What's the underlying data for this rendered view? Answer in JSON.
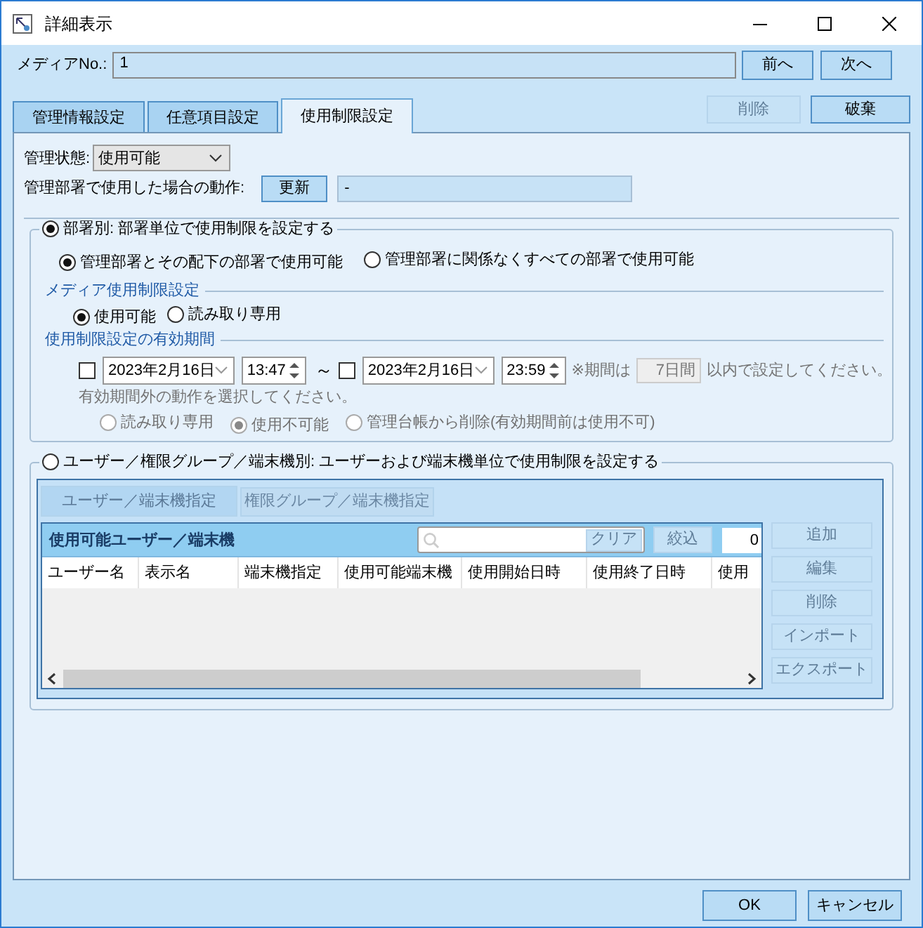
{
  "window": {
    "title": "詳細表示"
  },
  "media_no": {
    "label": "メディアNo.:",
    "value": "1"
  },
  "nav_buttons": [
    {
      "label": "前へ",
      "disabled": false
    },
    {
      "label": "次へ",
      "disabled": false
    }
  ],
  "tabs": [
    {
      "label": "管理情報設定",
      "selected": false
    },
    {
      "label": "任意項目設定",
      "selected": false
    },
    {
      "label": "使用制限設定",
      "selected": true
    }
  ],
  "tab_actions": [
    {
      "label": "削除",
      "disabled": true
    },
    {
      "label": "破棄",
      "disabled": false
    }
  ],
  "status": {
    "label": "管理状態:",
    "value": "使用可能"
  },
  "dept_action": {
    "label": "管理部署で使用した場合の動作:",
    "button": "更新",
    "value": "-"
  },
  "by_department": {
    "label": "部署別: 部署単位で使用制限を設定する",
    "selected": true,
    "scope_options": [
      {
        "label": "管理部署とその配下の部署で使用可能",
        "selected": true
      },
      {
        "label": "管理部署に関係なくすべての部署で使用可能",
        "selected": false
      }
    ],
    "media_section": {
      "title": "メディア使用制限設定",
      "options": [
        {
          "label": "使用可能",
          "selected": true
        },
        {
          "label": "読み取り専用",
          "selected": false
        }
      ]
    },
    "period_section": {
      "title": "使用制限設定の有効期間",
      "start": {
        "checked": false,
        "date": "2023年2月16日",
        "time": "13:47"
      },
      "separator": "～",
      "end": {
        "checked": false,
        "date": "2023年2月16日",
        "time": "23:59"
      },
      "note_prefix": "※期間は",
      "days": "7日間",
      "note_suffix": "以内で設定してください。",
      "outside_hint": "有効期間外の動作を選択してください。",
      "outside_options": [
        {
          "label": "読み取り専用",
          "selected": false,
          "disabled": true
        },
        {
          "label": "使用不可能",
          "selected": true,
          "disabled": true
        },
        {
          "label": "管理台帳から削除(有効期間前は使用不可)",
          "selected": false,
          "disabled": true
        }
      ]
    }
  },
  "by_user": {
    "label": "ユーザー／権限グループ／端末機別: ユーザーおよび端末機単位で使用制限を設定する",
    "selected": false,
    "tabs": [
      {
        "label": "ユーザー／端末機指定",
        "selected": true
      },
      {
        "label": "権限グループ／端末機指定",
        "selected": false
      }
    ],
    "list_title": "使用可能ユーザー／端末機",
    "clear_button": "クリア",
    "filter_button": "絞込",
    "count": "0",
    "columns": [
      "ユーザー名",
      "表示名",
      "端末機指定",
      "使用可能端末機",
      "使用開始日時",
      "使用終了日時",
      "使用"
    ],
    "side_buttons": [
      {
        "label": "追加",
        "disabled": true
      },
      {
        "label": "編集",
        "disabled": true
      },
      {
        "label": "削除",
        "disabled": true
      },
      {
        "label": "インポート",
        "disabled": true
      },
      {
        "label": "エクスポート",
        "disabled": true
      }
    ]
  },
  "footer_buttons": [
    {
      "label": "OK",
      "disabled": false
    },
    {
      "label": "キャンセル",
      "disabled": false
    }
  ]
}
